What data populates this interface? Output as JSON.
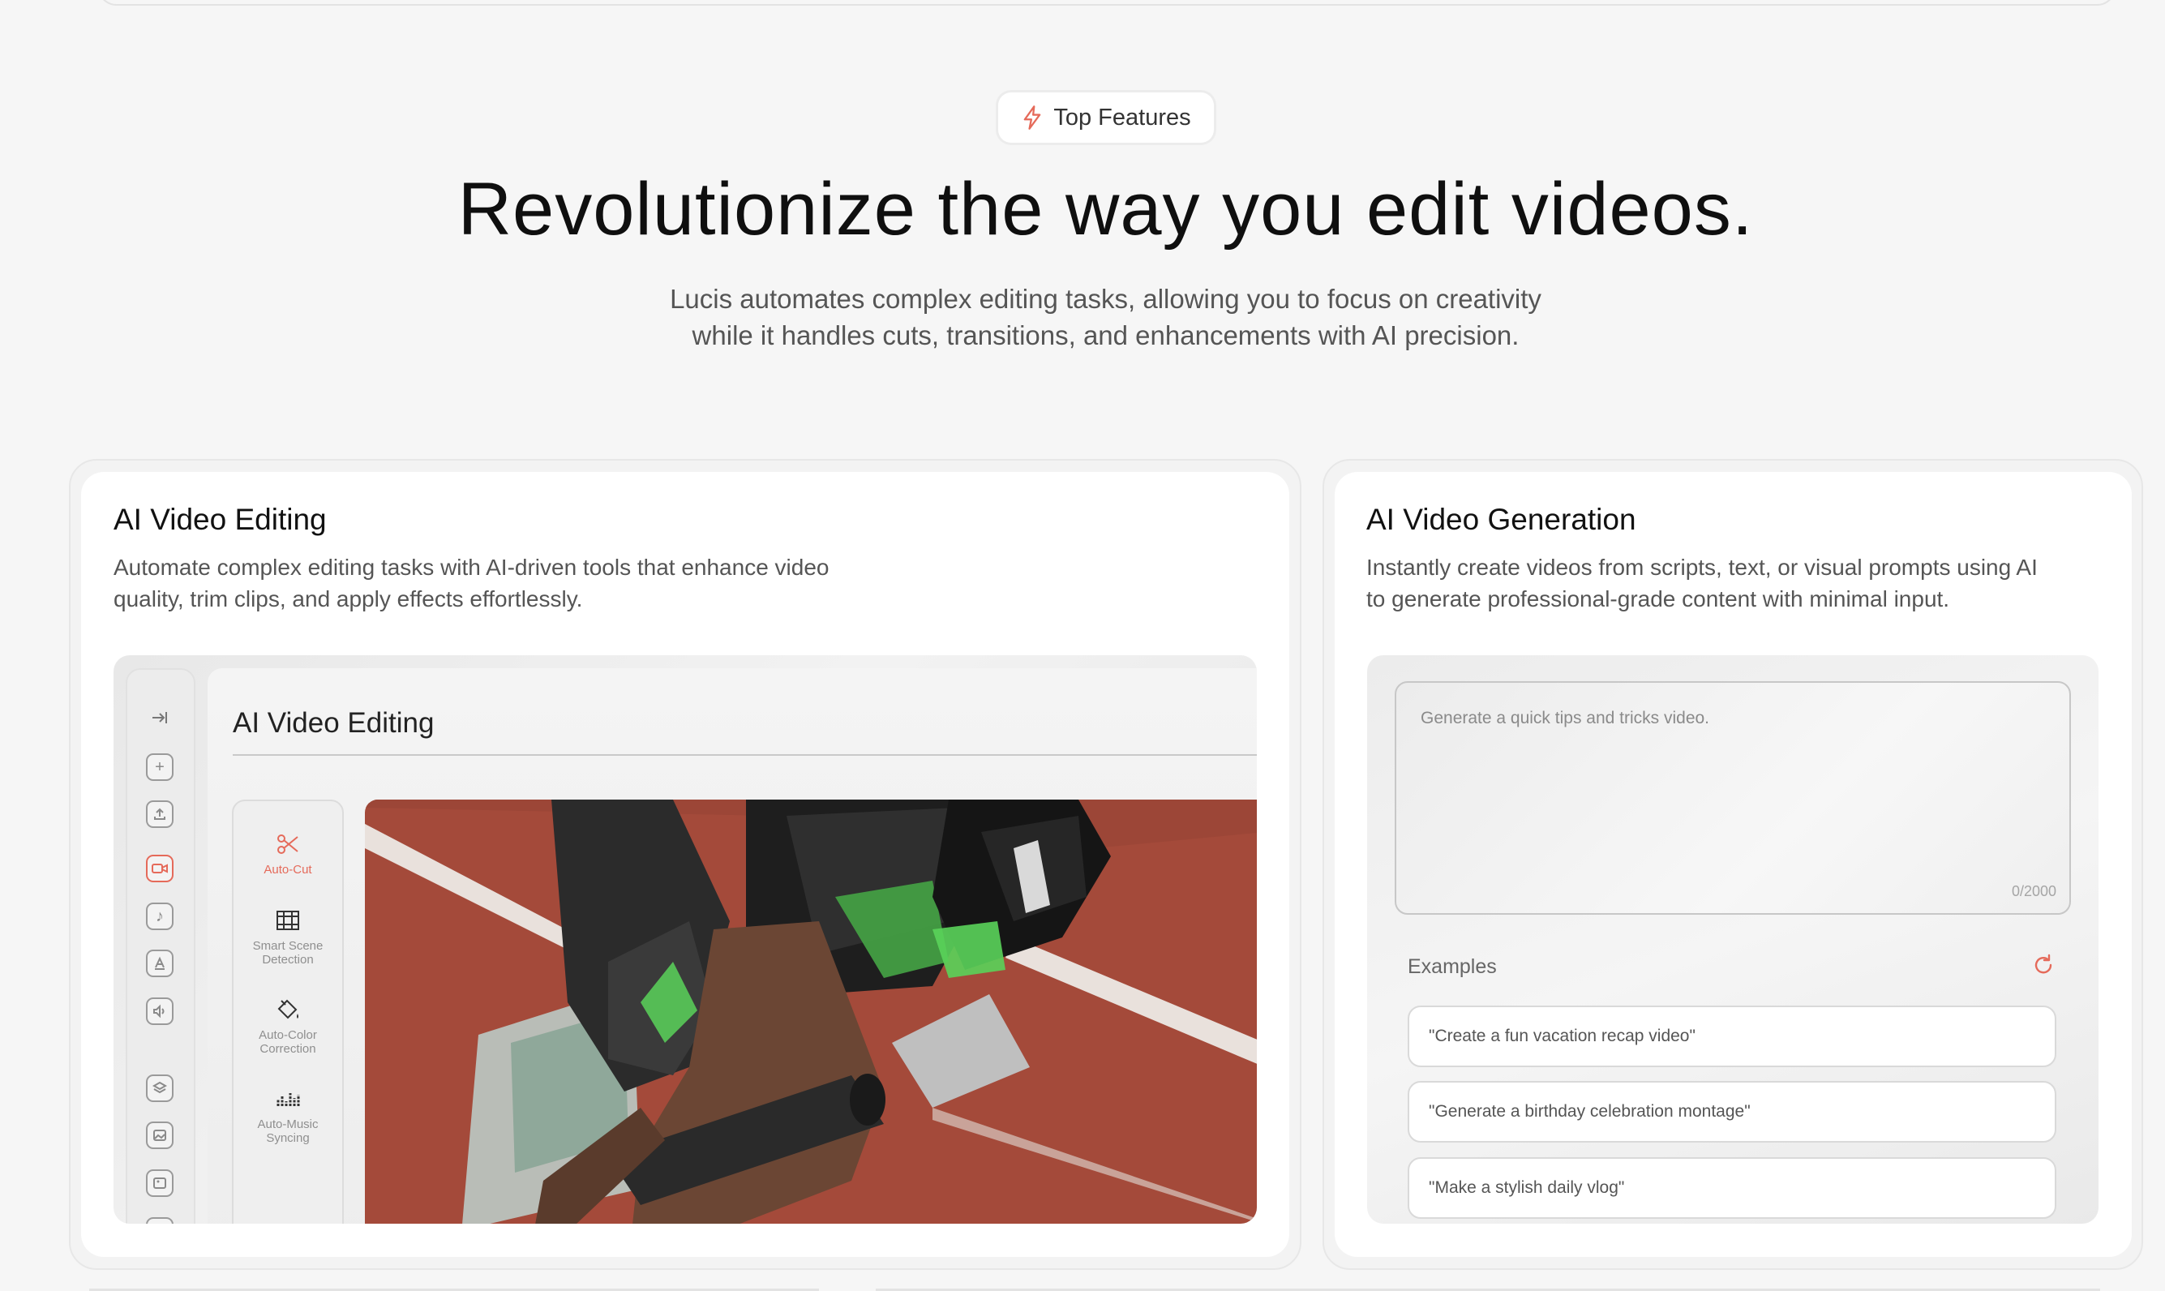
{
  "badge": {
    "label": "Top Features",
    "icon": "lightning-icon",
    "icon_color": "#e56a5a"
  },
  "hero": {
    "title": "Revolutionize the way you edit videos.",
    "subtitle_line1": "Lucis automates complex editing tasks, allowing you to focus on creativity",
    "subtitle_line2": "while it handles cuts, transitions, and enhancements with AI precision."
  },
  "editing_card": {
    "title": "AI Video Editing",
    "desc_line1": "Automate complex editing tasks with AI-driven tools that enhance video",
    "desc_line2": "quality, trim clips, and apply effects effortlessly.",
    "editor": {
      "title": "AI Video Editing",
      "rail_icons": [
        "collapse-icon",
        "plus-icon",
        "upload-icon",
        "video-icon",
        "music-icon",
        "text-icon",
        "audio-icon",
        "layers-icon",
        "image-icon",
        "gallery-icon"
      ],
      "active_rail": "video-icon",
      "tools": [
        {
          "line1": "Auto-Cut",
          "line2": "",
          "icon": "scissors-icon",
          "active": true
        },
        {
          "line1": "Smart Scene",
          "line2": "Detection",
          "icon": "film-grid-icon",
          "active": false
        },
        {
          "line1": "Auto-Color",
          "line2": "Correction",
          "icon": "paint-bucket-icon",
          "active": false
        },
        {
          "line1": "Auto-Music",
          "line2": "Syncing",
          "icon": "equalizer-icon",
          "active": false
        }
      ]
    }
  },
  "generation_card": {
    "title": "AI Video Generation",
    "desc_line1": "Instantly create videos from scripts, text, or visual prompts using AI",
    "desc_line2": "to generate professional-grade content with minimal input.",
    "prompt_placeholder": "Generate a quick tips and tricks video.",
    "prompt_count": "0/2000",
    "examples_label": "Examples",
    "examples": [
      "\"Create a fun vacation recap video\"",
      "\"Generate a birthday celebration montage\"",
      "\"Make a stylish daily vlog\""
    ]
  },
  "colors": {
    "accent": "#e56a5a",
    "background": "#f6f6f6"
  }
}
